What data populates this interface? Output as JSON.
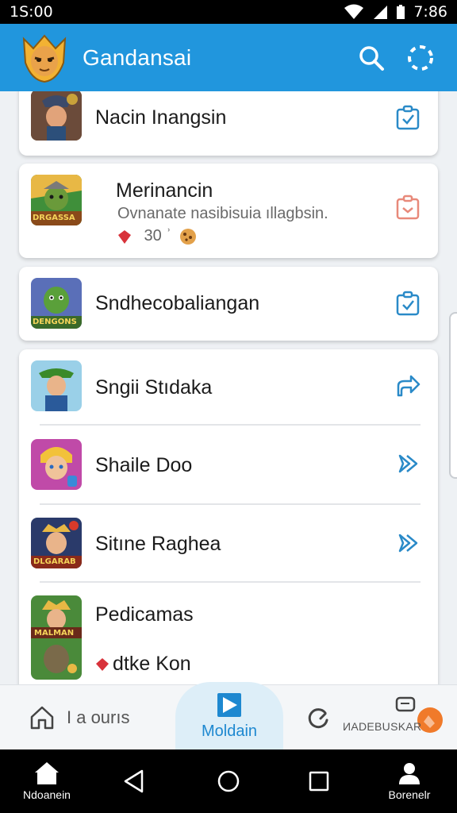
{
  "status_bar": {
    "time": "1S:00",
    "clock": "7:86"
  },
  "app_bar": {
    "title": "Gandansai",
    "search_icon": "search-icon",
    "more_icon": "dotted-circle-icon"
  },
  "list": {
    "items": [
      {
        "title": "Nacin Inangsin",
        "action_icon": "clipboard-check-icon"
      },
      {
        "title": "Merinancin",
        "subtitle": "Ovnanate nasibisuia ıllagbsin.",
        "meta_value": " 30 ʾ",
        "thumb_caption": "DRGASSA",
        "action_icon": "clipboard-remove-icon"
      },
      {
        "title": "Sndhecobaliangan",
        "thumb_caption": "DENGONS",
        "action_icon": "clipboard-check-icon"
      },
      {
        "title": "Sngii Stıdaka",
        "action_icon": "share-icon"
      },
      {
        "title": "Shaile Doo",
        "action_icon": "double-chevron-right-icon"
      },
      {
        "title": "Sitıne Raghea",
        "thumb_caption": "DLGARAB",
        "action_icon": "double-chevron-right-icon"
      },
      {
        "title": "Pedicamas",
        "subtitle": "dtke Kon",
        "thumb_caption": "MALMAN"
      }
    ]
  },
  "bottom_bar": {
    "left_label": "I a ourıs",
    "center_label": "Moldain",
    "right_label": "ИADEBUSKAR"
  },
  "nav_bar": {
    "home_label": "Ndoanein",
    "profile_label": "Borenelr"
  },
  "colors": {
    "primary": "#2196dd",
    "accent_icon": "#2a8ac8",
    "danger_icon": "#e8897a"
  }
}
